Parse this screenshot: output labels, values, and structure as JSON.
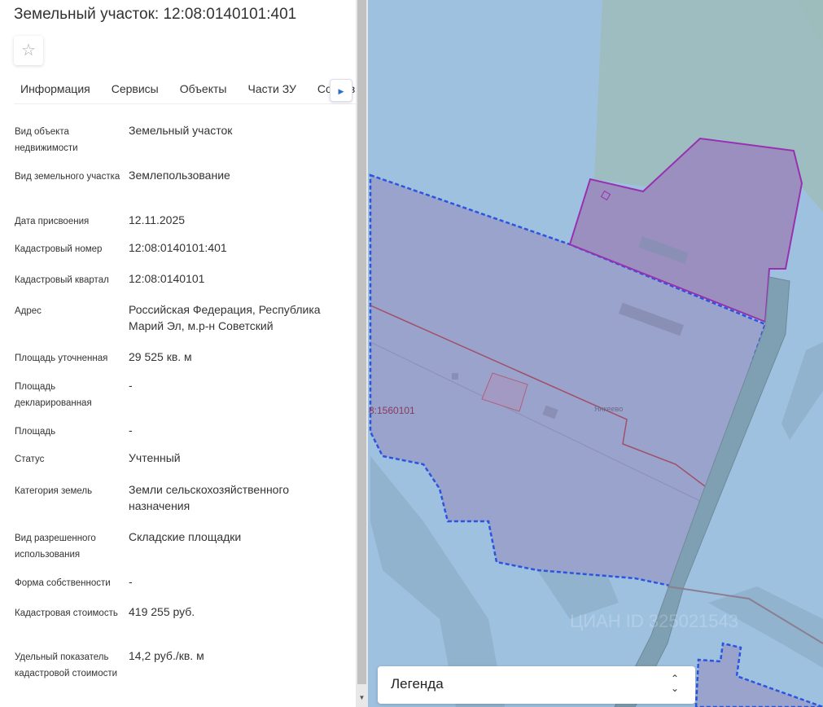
{
  "header": {
    "title": "Земельный участок: 12:08:0140101:401",
    "favorite_icon": "star-icon"
  },
  "tabs": [
    {
      "label": "Информация"
    },
    {
      "label": "Сервисы"
    },
    {
      "label": "Объекты"
    },
    {
      "label": "Части ЗУ"
    },
    {
      "label": "Состав"
    }
  ],
  "fields": [
    {
      "label": "Вид объекта недвижимости",
      "value": "Земельный участок"
    },
    {
      "label": "Вид земельного участка",
      "value": "Землепользование"
    },
    {
      "label": "Дата присвоения",
      "value": "12.11.2025"
    },
    {
      "label": "Кадастровый номер",
      "value": "12:08:0140101:401"
    },
    {
      "label": "Кадастровый квартал",
      "value": "12:08:0140101"
    },
    {
      "label": "Адрес",
      "value": "Российская Федерация, Республика Марий Эл, м.р-н Советский"
    },
    {
      "label": "Площадь уточненная",
      "value": "29 525 кв. м"
    },
    {
      "label": "Площадь декларированная",
      "value": "-"
    },
    {
      "label": "Площадь",
      "value": "-"
    },
    {
      "label": "Статус",
      "value": "Учтенный"
    },
    {
      "label": "Категория земель",
      "value": "Земли сельскохозяйственного назначения"
    },
    {
      "label": "Вид разрешенного использования",
      "value": "Складские площадки"
    },
    {
      "label": "Форма собственности",
      "value": "-"
    },
    {
      "label": "Кадастровая стоимость",
      "value": "419 255 руб."
    },
    {
      "label": "Удельный показатель кадастровой стоимости",
      "value": "14,2 руб./кв. м"
    }
  ],
  "map": {
    "quarter_label": "8:1560101",
    "place_label": "Янкеево",
    "watermark": "ЦИАН ID 325021543",
    "legend_label": "Легенда"
  }
}
